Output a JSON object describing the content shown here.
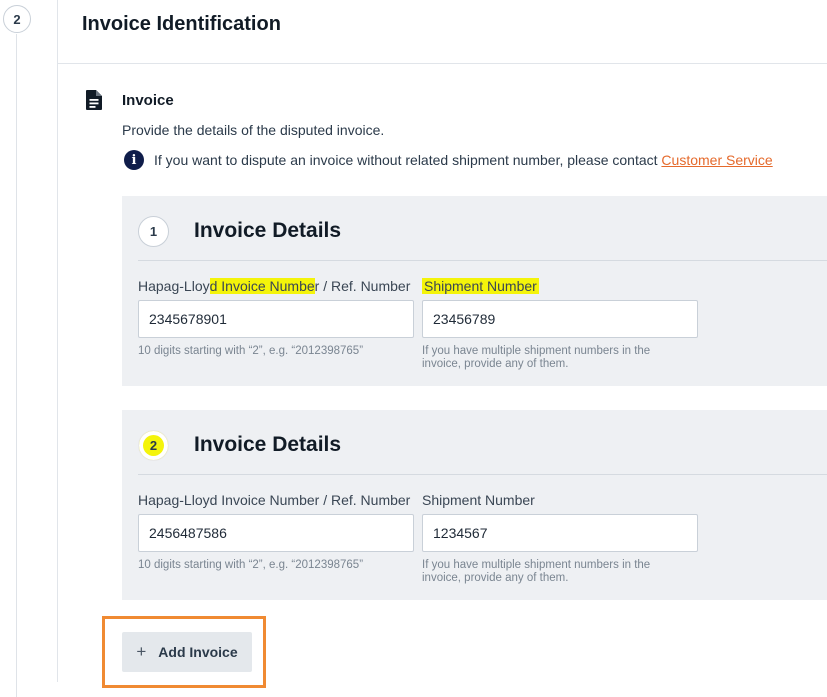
{
  "step": {
    "number": "2"
  },
  "section": {
    "title": "Invoice Identification"
  },
  "invoice": {
    "heading": "Invoice",
    "description": "Provide the details of the disputed invoice.",
    "info_text": "If you want to dispute an invoice without related shipment number, please contact ",
    "info_link": "Customer Service",
    "info_icon": "info-icon",
    "doc_icon": "document-icon"
  },
  "cards": [
    {
      "number": "1",
      "title": "Invoice Details",
      "label_prefix": "Hapag-Lloy",
      "label_highlight": "d Invoice Numbe",
      "label_suffix": "r / Ref. Number",
      "shipment_label": "Shipment Number",
      "invoice_value": "2345678901",
      "shipment_value": "23456789",
      "invoice_hint": "10 digits starting with “2”, e.g. “2012398765”",
      "shipment_hint": "If you have multiple shipment numbers in the invoice, provide any of them."
    },
    {
      "number": "2",
      "title": "Invoice Details",
      "invoice_label": "Hapag-Lloyd Invoice Number / Ref. Number",
      "shipment_label": "Shipment Number",
      "invoice_value": "2456487586",
      "shipment_value": "1234567",
      "invoice_hint": "10 digits starting with “2”, e.g. “2012398765”",
      "shipment_hint": "If you have multiple shipment numbers in the invoice, provide any of them."
    }
  ],
  "actions": {
    "add_invoice": "Add Invoice",
    "add_icon": "+"
  },
  "colors": {
    "highlight": "#f4f40a",
    "link": "#e56a2c",
    "annotation_box": "#f08a32",
    "card_bg": "#eef0f3"
  }
}
